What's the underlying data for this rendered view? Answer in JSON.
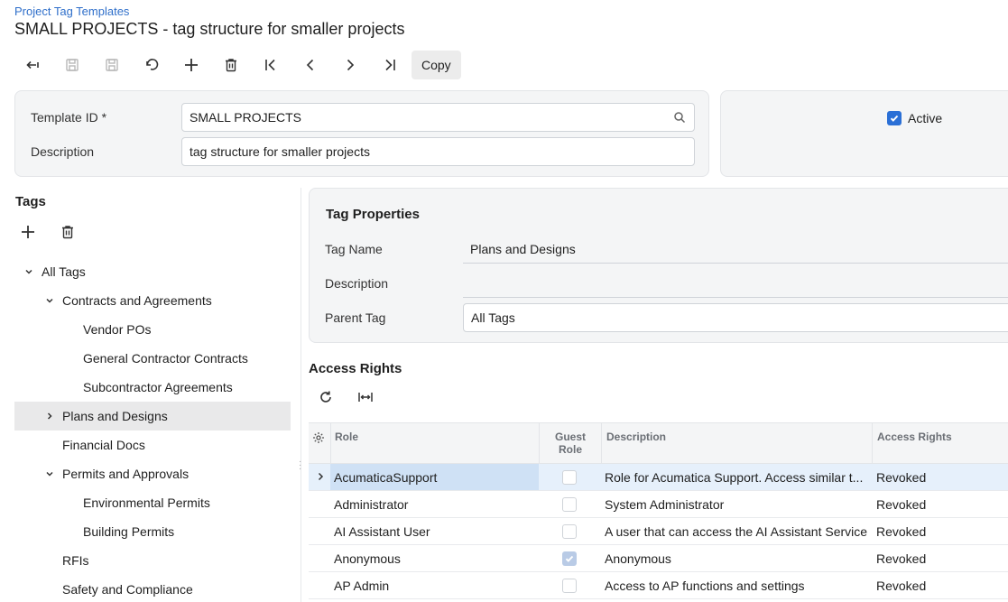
{
  "breadcrumb": "Project Tag Templates",
  "page_title": "SMALL PROJECTS - tag structure for smaller projects",
  "toolbar": {
    "copy_label": "Copy",
    "icons": [
      "back-icon",
      "save-icon",
      "save-close-icon",
      "undo-icon",
      "add-icon",
      "delete-icon",
      "first-record-icon",
      "previous-record-icon",
      "next-record-icon",
      "last-record-icon"
    ]
  },
  "summary": {
    "template_id_label": "Template ID *",
    "template_id_value": "SMALL PROJECTS",
    "description_label": "Description",
    "description_value": "tag structure for smaller projects",
    "active_label": "Active",
    "active_checked": true
  },
  "tags": {
    "title": "Tags",
    "tree": [
      {
        "label": "All Tags",
        "level": 0,
        "expander": "expanded"
      },
      {
        "label": "Contracts and Agreements",
        "level": 1,
        "expander": "expanded"
      },
      {
        "label": "Vendor POs",
        "level": 2,
        "expander": "none"
      },
      {
        "label": "General Contractor Contracts",
        "level": 2,
        "expander": "none"
      },
      {
        "label": "Subcontractor Agreements",
        "level": 2,
        "expander": "none"
      },
      {
        "label": "Plans and Designs",
        "level": 1,
        "expander": "collapsed",
        "selected": true
      },
      {
        "label": "Financial Docs",
        "level": 1,
        "expander": "none"
      },
      {
        "label": "Permits and Approvals",
        "level": 1,
        "expander": "expanded"
      },
      {
        "label": "Environmental Permits",
        "level": 2,
        "expander": "none"
      },
      {
        "label": "Building Permits",
        "level": 2,
        "expander": "none"
      },
      {
        "label": "RFIs",
        "level": 1,
        "expander": "none"
      },
      {
        "label": "Safety and Compliance",
        "level": 1,
        "expander": "none"
      }
    ]
  },
  "tag_properties": {
    "title": "Tag Properties",
    "tag_name_label": "Tag Name",
    "tag_name_value": "Plans and Designs",
    "description_label": "Description",
    "description_value": "",
    "parent_tag_label": "Parent Tag",
    "parent_tag_value": "All Tags"
  },
  "access_rights": {
    "title": "Access Rights",
    "columns": {
      "role": "Role",
      "guest_role_line1": "Guest",
      "guest_role_line2": "Role",
      "description": "Description",
      "access_rights": "Access Rights"
    },
    "rows": [
      {
        "role": "AcumaticaSupport",
        "guest_role": false,
        "description": "Role for Acumatica Support. Access similar t...",
        "access_rights": "Revoked",
        "selected": true
      },
      {
        "role": "Administrator",
        "guest_role": false,
        "description": "System Administrator",
        "access_rights": "Revoked"
      },
      {
        "role": "AI Assistant User",
        "guest_role": false,
        "description": "A user that can access the AI Assistant Service",
        "access_rights": "Revoked"
      },
      {
        "role": "Anonymous",
        "guest_role": true,
        "description": "Anonymous",
        "access_rights": "Revoked"
      },
      {
        "role": "AP Admin",
        "guest_role": false,
        "description": "Access to AP functions and settings",
        "access_rights": "Revoked"
      }
    ]
  },
  "colors": {
    "accent": "#2a6fd6",
    "link": "#2f6fca",
    "selected_row": "#e6f0fb"
  }
}
